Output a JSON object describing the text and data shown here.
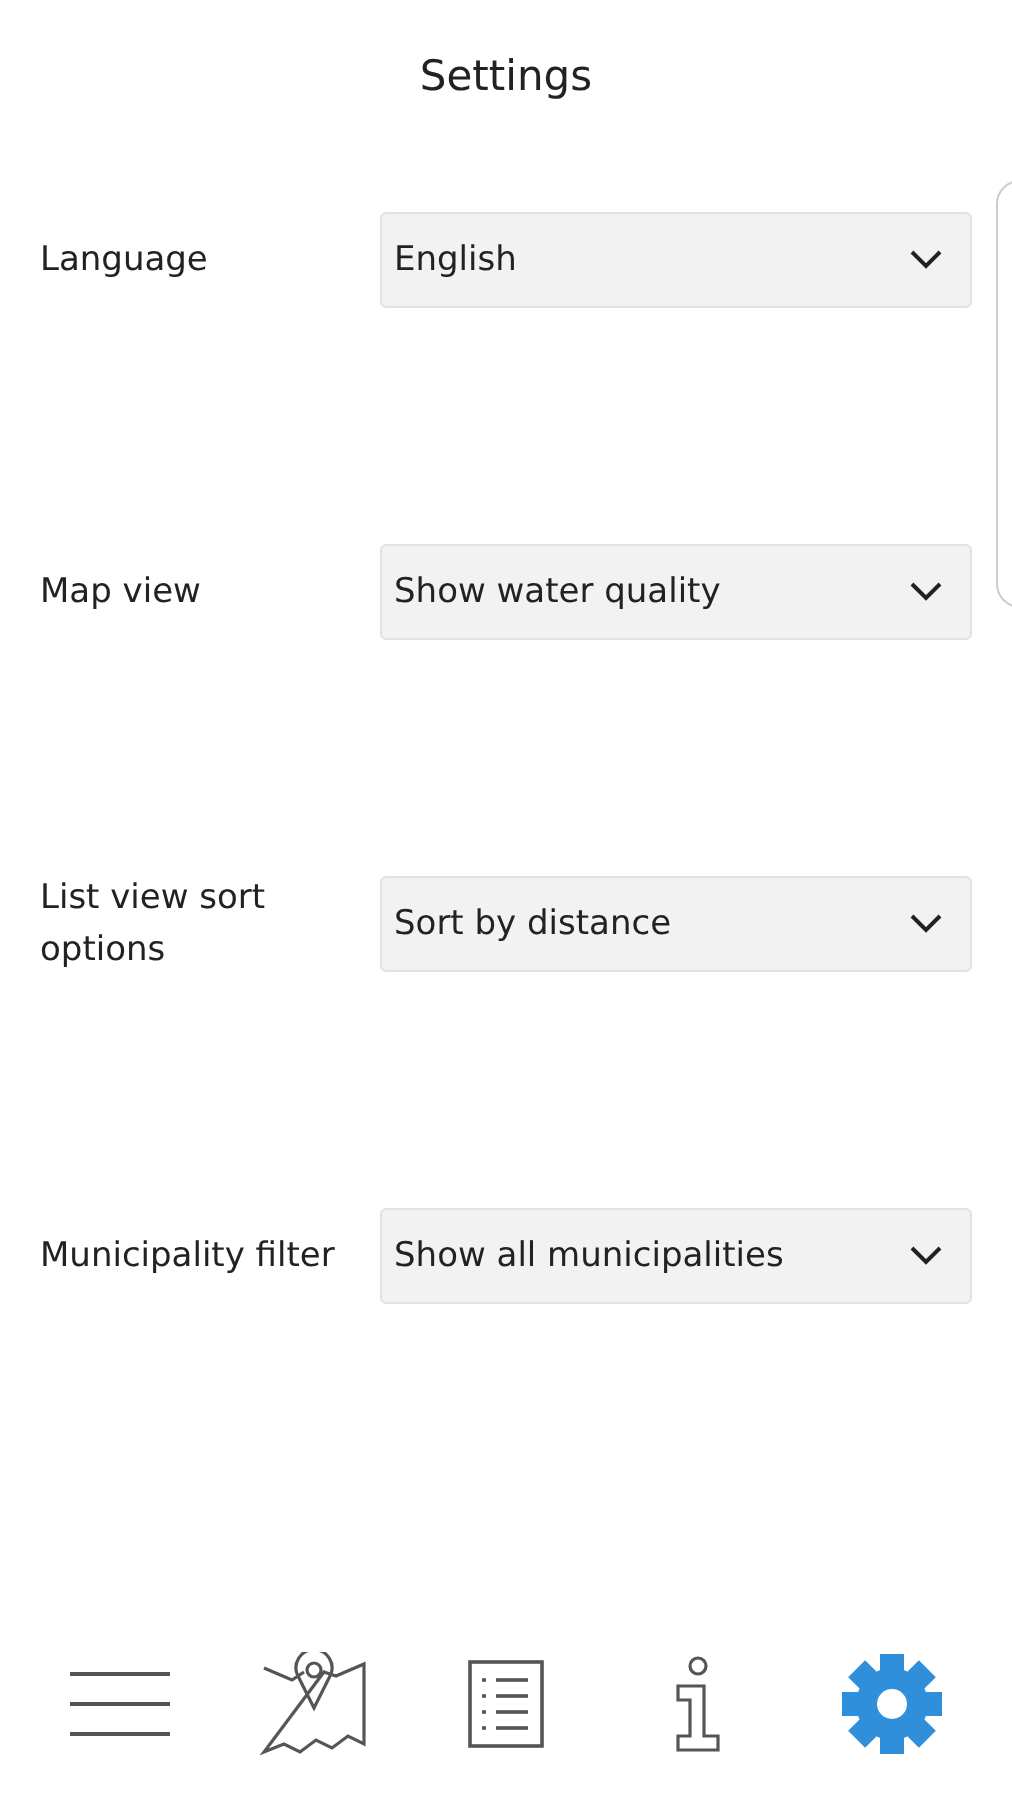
{
  "header": {
    "title": "Settings"
  },
  "settings": [
    {
      "label": "Language",
      "value": "English"
    },
    {
      "label": "Map view",
      "value": "Show water quality"
    },
    {
      "label": "List view sort options",
      "value": "Sort by distance"
    },
    {
      "label": "Municipality filter",
      "value": "Show all municipalities"
    }
  ],
  "bottom_nav": [
    {
      "kind": "menu",
      "selected": false
    },
    {
      "kind": "map",
      "selected": false
    },
    {
      "kind": "list",
      "selected": false
    },
    {
      "kind": "info",
      "selected": false
    },
    {
      "kind": "settings",
      "selected": true
    }
  ]
}
